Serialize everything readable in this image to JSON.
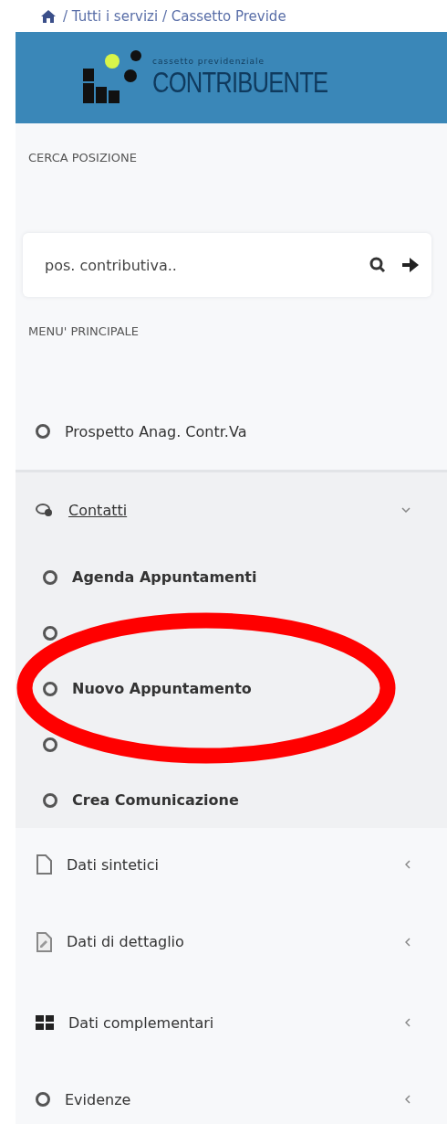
{
  "breadcrumb": [
    "/ Tutti i servizi / Cassetto Previde"
  ],
  "header": {
    "logo_subtitle": "cassetto previdenziale",
    "logo_title": "CONTRIBUENTE"
  },
  "search_section": {
    "title": "CERCA POSIZIONE",
    "placeholder": "pos. contributiva.."
  },
  "menu": {
    "title": "MENU' PRINCIPALE",
    "items": [
      {
        "label": "Prospetto Anag. Contr.Va",
        "expanded": false,
        "has_children": false
      },
      {
        "label": "Contatti",
        "expanded": true,
        "has_children": true,
        "children": [
          {
            "kind": "link",
            "label": "Agenda Appuntamenti"
          },
          {
            "kind": "covered"
          },
          {
            "kind": "link",
            "label": "Nuovo Appuntamento"
          },
          {
            "kind": "covered"
          },
          {
            "kind": "link",
            "label": "Crea Comunicazione"
          }
        ]
      },
      {
        "label": "Dati sintetici",
        "expanded": false,
        "has_children": true
      },
      {
        "label": "Dati di dettaglio",
        "expanded": false,
        "has_children": true
      },
      {
        "label": "Dati complementari",
        "expanded": false,
        "has_children": true
      },
      {
        "label": "Evidenze",
        "expanded": false,
        "has_children": true
      }
    ]
  },
  "annotation": {
    "kind": "ellipse"
  }
}
